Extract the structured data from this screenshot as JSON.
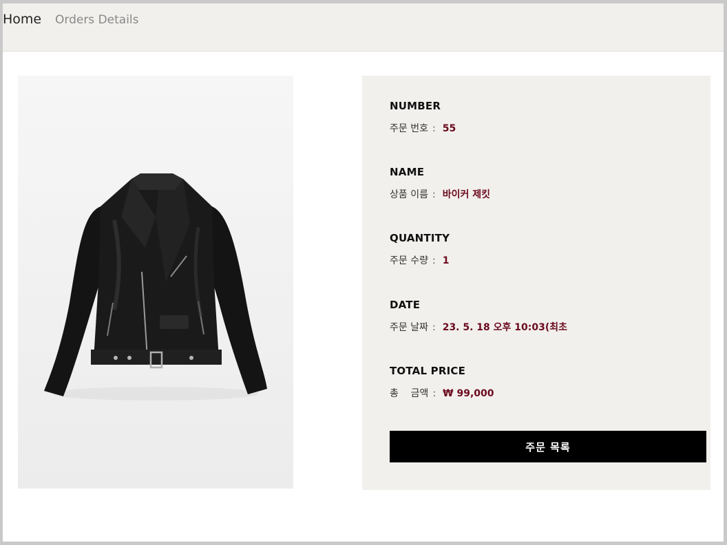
{
  "nav": {
    "home": "Home",
    "orders_details": "Orders Details"
  },
  "order": {
    "number": {
      "title": "NUMBER",
      "label": "주문 번호",
      "value": "55"
    },
    "name": {
      "title": "NAME",
      "label": "상품 이름",
      "value": "바이커 제킷"
    },
    "quantity": {
      "title": "QUANTITY",
      "label": "주문 수량",
      "value": "1"
    },
    "date": {
      "title": "DATE",
      "label": "주문 날짜",
      "value": "23. 5. 18 오후 10:03(최초"
    },
    "total": {
      "title": "TOTAL PRICE",
      "label": "총    금액",
      "value": "₩ 99,000"
    },
    "separator": ":"
  },
  "actions": {
    "order_list": "주문 목록"
  },
  "product_image": {
    "subject": "black-leather-biker-jacket"
  },
  "colors": {
    "value_text": "#6b0a1e",
    "panel_bg": "#f2f0ed",
    "button_bg": "#000000"
  }
}
